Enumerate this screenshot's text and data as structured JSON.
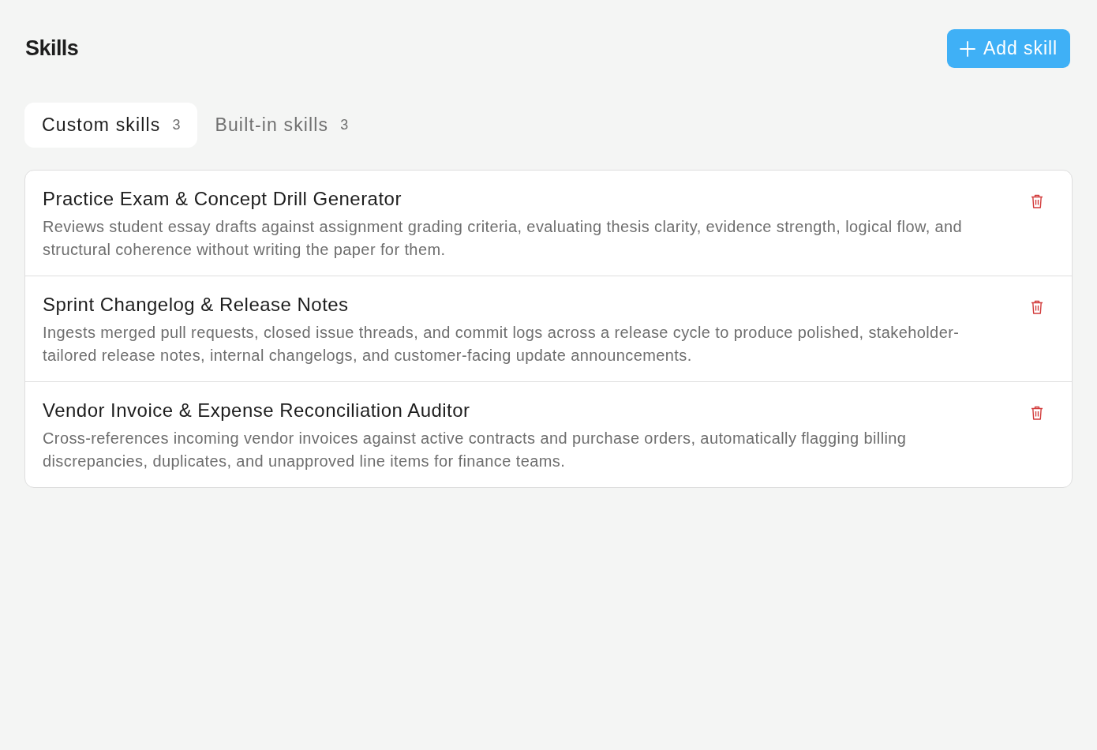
{
  "header": {
    "title": "Skills",
    "add_button": {
      "label": "Add skill"
    }
  },
  "tabs": [
    {
      "label": "Custom skills",
      "count": "3",
      "selected": true
    },
    {
      "label": "Built-in skills",
      "count": "3",
      "selected": false
    }
  ],
  "skills": [
    {
      "name": "Practice Exam & Concept Drill Generator",
      "description": "Reviews student essay drafts against assignment grading criteria, evaluating thesis clarity, evidence strength, logical flow, and structural coherence without writing the paper for them."
    },
    {
      "name": "Sprint Changelog & Release Notes",
      "description": "Ingests merged pull requests, closed issue threads, and commit logs across a release cycle to produce polished, stakeholder-tailored release notes, internal changelogs, and customer-facing update announcements."
    },
    {
      "name": "Vendor Invoice & Expense Reconciliation Auditor",
      "description": "Cross-references incoming vendor invoices against active contracts and purchase orders, automatically flagging billing discrepancies, duplicates, and unapproved line items for finance teams."
    }
  ]
}
